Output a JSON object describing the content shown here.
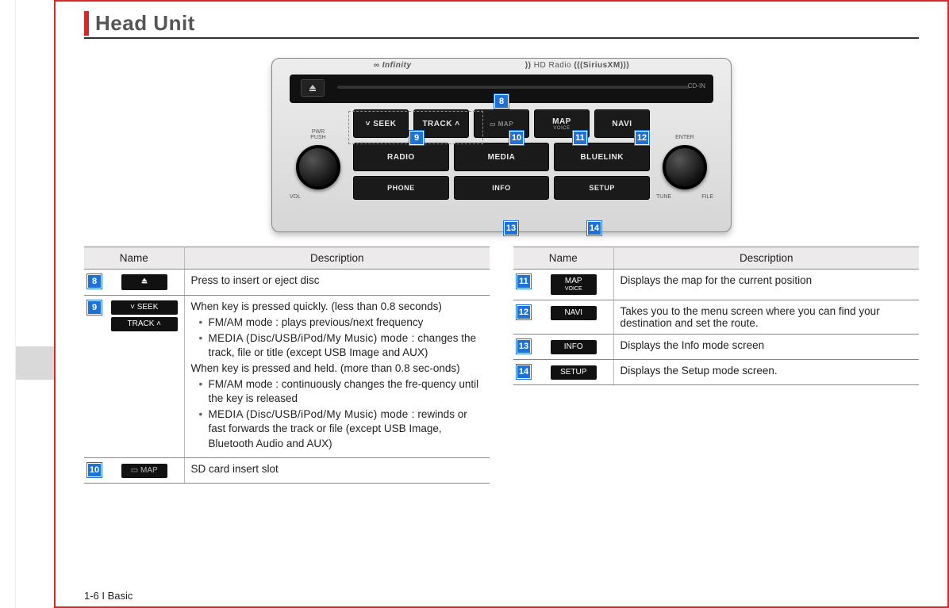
{
  "page": {
    "title": "Head Unit",
    "footer": "1-6 I Basic"
  },
  "brands": {
    "infinity": "Infinity",
    "hdradio": "HD Radio",
    "siriusxm": "SiriusXM",
    "cdin": "CD-IN"
  },
  "buttons": {
    "seek": "SEEK",
    "track": "TRACK",
    "sdmap_icon": "SD",
    "sdmap": "MAP",
    "mapvoice_top": "MAP",
    "mapvoice_sub": "VOICE",
    "navi": "NAVI",
    "radio": "RADIO",
    "media": "MEDIA",
    "bluelink": "BLUELINK",
    "phone": "PHONE",
    "info": "INFO",
    "setup": "SETUP"
  },
  "knob_labels": {
    "left_top1": "PWR",
    "left_top2": "PUSH",
    "left_b1": "VOL",
    "left_b2": "",
    "right_top": "ENTER",
    "right_b1": "TUNE",
    "right_b2": "FILE"
  },
  "callouts": {
    "c8": "8",
    "c9": "9",
    "c10": "10",
    "c11": "11",
    "c12": "12",
    "c13": "13",
    "c14": "14"
  },
  "tables": {
    "headers": {
      "name": "Name",
      "desc": "Description"
    },
    "left": [
      {
        "num": "8",
        "name_eject": true,
        "desc_plain": "Press to insert or eject disc"
      },
      {
        "num": "9",
        "name_seek": true,
        "desc_seek": {
          "quick_intro": "When key is pressed quickly. (less than 0.8 seconds)",
          "quick_b1": "FM/AM mode : plays previous/next frequency",
          "quick_b2a": "MEDIA (Disc/USB/iPod/My Music) mode :",
          "quick_b2b": "changes the track, file or title (except USB Image and AUX)",
          "hold_intro": "When key is pressed and held. (more than 0.8 sec-onds)",
          "hold_b1": "FM/AM mode : continuously changes the fre-quency until the key is released",
          "hold_b2a": "MEDIA (Disc/USB/iPod/My Music) mode :",
          "hold_b2b": "rewinds or fast forwards the track or file (except USB Image, Bluetooth Audio and AUX)"
        }
      },
      {
        "num": "10",
        "name_sd": true,
        "desc_plain": "SD card insert slot"
      }
    ],
    "right": [
      {
        "num": "11",
        "chip_top": "MAP",
        "chip_sub": "VOICE",
        "desc": "Displays the map for the current position"
      },
      {
        "num": "12",
        "chip": "NAVI",
        "desc": "Takes you to the menu screen where you can find your destination and set the route."
      },
      {
        "num": "13",
        "chip": "INFO",
        "desc": "Displays the Info mode screen"
      },
      {
        "num": "14",
        "chip": "SETUP",
        "desc": "Displays the Setup mode screen."
      }
    ]
  }
}
